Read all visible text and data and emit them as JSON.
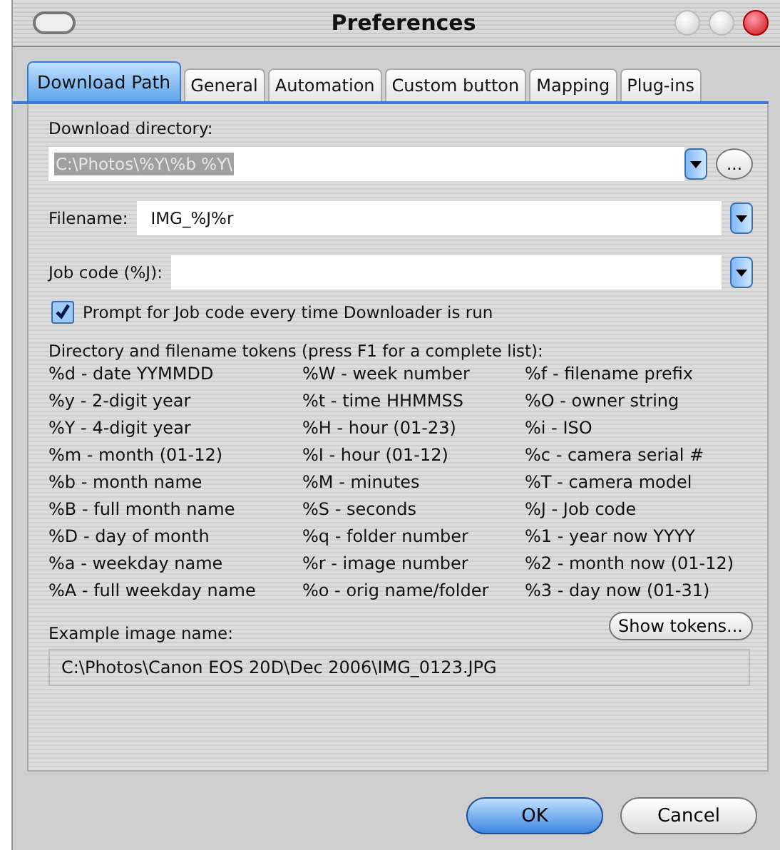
{
  "window": {
    "title": "Preferences"
  },
  "tabs": [
    {
      "label": "Download Path",
      "selected": true
    },
    {
      "label": "General",
      "selected": false
    },
    {
      "label": "Automation",
      "selected": false
    },
    {
      "label": "Custom button",
      "selected": false
    },
    {
      "label": "Mapping",
      "selected": false
    },
    {
      "label": "Plug-ins",
      "selected": false
    }
  ],
  "download_directory": {
    "label": "Download directory:",
    "value": "C:\\Photos\\%Y\\%b %Y\\",
    "browse": "...",
    "selected": true
  },
  "filename": {
    "label": "Filename:",
    "value": "IMG_%J%r"
  },
  "job_code": {
    "label": "Job code (%J):"
  },
  "prompt_checkbox": {
    "label": "Prompt for Job code every time Downloader is run",
    "checked": true
  },
  "tokens_heading": "Directory and filename tokens (press F1 for a complete list):",
  "tokens": [
    [
      "%d - date YYMMDD",
      "%W - week number",
      "%f - filename prefix"
    ],
    [
      "%y - 2-digit year",
      "%t - time HHMMSS",
      "%O - owner string"
    ],
    [
      "%Y - 4-digit year",
      "%H - hour (01-23)",
      "%i - ISO"
    ],
    [
      "%m - month (01-12)",
      "%I - hour (01-12)",
      "%c - camera serial #"
    ],
    [
      "%b - month name",
      "%M - minutes",
      "%T - camera model"
    ],
    [
      "%B - full month name",
      "%S - seconds",
      "%J - Job code"
    ],
    [
      "%D - day of month",
      "%q - folder number",
      "%1 - year now YYYY"
    ],
    [
      "%a - weekday name",
      "%r - image number",
      "%2 - month now (01-12)"
    ],
    [
      "%A - full weekday name",
      "%o - orig name/folder",
      "%3 - day now (01-31)"
    ]
  ],
  "show_tokens_button": "Show tokens...",
  "example": {
    "label": "Example image name:",
    "value": "C:\\Photos\\Canon EOS 20D\\Dec 2006\\IMG_0123.JPG"
  },
  "buttons": [
    {
      "label": "OK",
      "default": true
    },
    {
      "label": "Cancel",
      "default": false
    }
  ]
}
